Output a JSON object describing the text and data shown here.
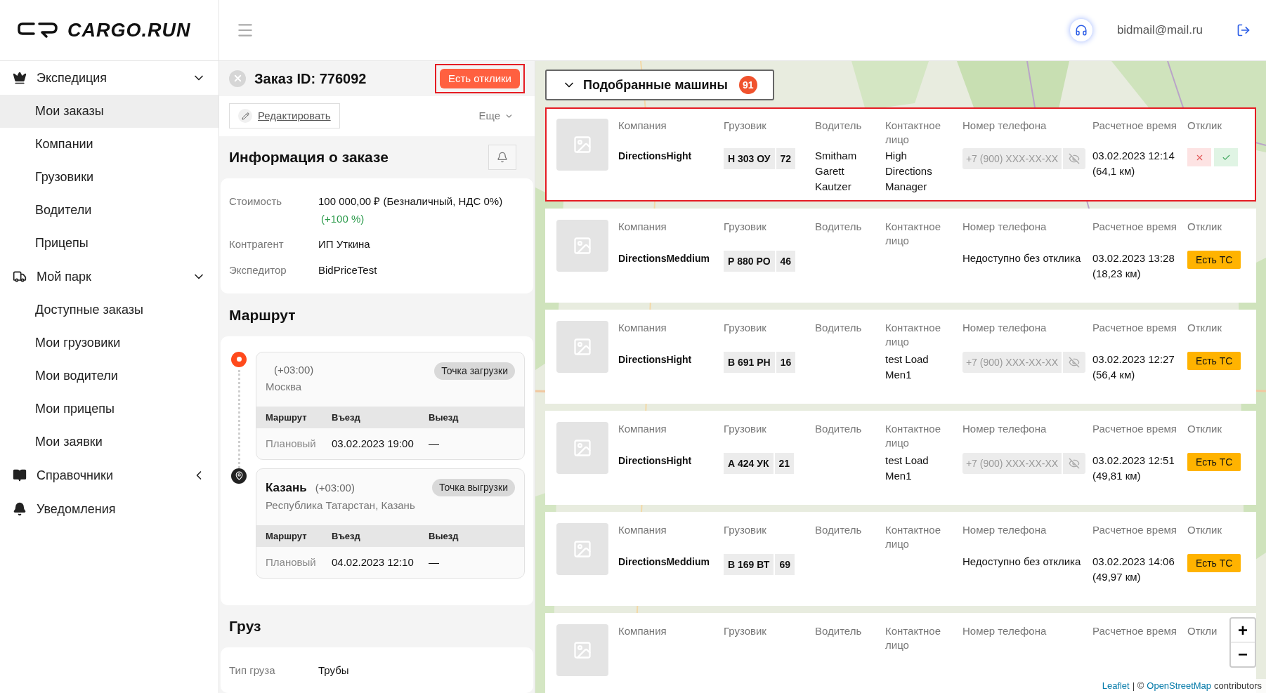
{
  "header": {
    "logo_text": "CARGO.RUN",
    "user_email": "bidmail@mail.ru"
  },
  "sidebar": {
    "groups": [
      {
        "label": "Экспедиция",
        "expanded": true,
        "items": [
          {
            "label": "Мои заказы",
            "selected": true
          },
          {
            "label": "Компании",
            "selected": false
          },
          {
            "label": "Грузовики",
            "selected": false
          },
          {
            "label": "Водители",
            "selected": false
          },
          {
            "label": "Прицепы",
            "selected": false
          }
        ]
      },
      {
        "label": "Мой парк",
        "expanded": true,
        "items": [
          {
            "label": "Доступные заказы",
            "selected": false
          },
          {
            "label": "Мои грузовики",
            "selected": false
          },
          {
            "label": "Мои водители",
            "selected": false
          },
          {
            "label": "Мои прицепы",
            "selected": false
          },
          {
            "label": "Мои заявки",
            "selected": false
          }
        ]
      },
      {
        "label": "Справочники",
        "expanded": false
      },
      {
        "label": "Уведомления"
      }
    ]
  },
  "order": {
    "title": "Заказ ID: 776092",
    "status_button": {
      "label": "Есть отклики",
      "highlighted": true
    },
    "edit_link": "Редактировать",
    "more_label": "Еще",
    "info": {
      "title": "Информация о заказе",
      "rows": [
        {
          "label": "Стоимость",
          "value": "100 000,00 ₽ (Безналичный, НДС 0%)",
          "note": "(+100 %)"
        },
        {
          "label": "Контрагент",
          "value": "ИП Уткина"
        },
        {
          "label": "Экспедитор",
          "value": "BidPriceTest"
        }
      ]
    },
    "route": {
      "title": "Маршрут",
      "points": [
        {
          "kind": "loading",
          "timezone": "(+03:00)",
          "address": "Москва",
          "tag": "Точка загрузки",
          "columns": [
            "Маршрут",
            "Въезд",
            "Выезд"
          ],
          "row": [
            "Плановый",
            "03.02.2023 19:00",
            "—"
          ]
        },
        {
          "kind": "unloading",
          "city": "Казань",
          "timezone": "(+03:00)",
          "address": "Республика Татарстан, Казань",
          "tag": "Точка выгрузки",
          "columns": [
            "Маршрут",
            "Въезд",
            "Выезд"
          ],
          "row": [
            "Плановый",
            "04.02.2023 12:10",
            "—"
          ]
        }
      ]
    },
    "cargo": {
      "title": "Груз",
      "rows": [
        {
          "label": "Тип груза",
          "value": "Трубы"
        }
      ]
    }
  },
  "matches": {
    "title": "Подобранные машины",
    "count": "91",
    "expanded": true,
    "cards": [
      {
        "kind": "response",
        "highlighted": true,
        "labels": [
          "Компания",
          "Грузовик",
          "Водитель",
          "Контактное лицо",
          "Номер телефона",
          "Расчетное время",
          "Отклик"
        ],
        "company": "DirectionsHight",
        "plate": "Н 303 ОУ",
        "region": "72",
        "driver": "Smitham Garett Kautzer",
        "contact": "High Directions Manager",
        "phone_masked": true,
        "phone": "+7 (900) XXX-XX-XX",
        "time": "03.02.2023 12:14",
        "distance": "(64,1 км)"
      },
      {
        "kind": "available",
        "highlighted": false,
        "labels": [
          "Компания",
          "Грузовик",
          "Водитель",
          "Контактное лицо",
          "Номер телефона",
          "Расчетное время",
          "Отклик"
        ],
        "company": "DirectionsMeddium",
        "plate": "Р 880 РО",
        "region": "46",
        "phone_masked": false,
        "phone": "Недоступно без отклика",
        "time": "03.02.2023 13:28",
        "distance": "(18,23 км)",
        "action": "Есть ТС"
      },
      {
        "kind": "available",
        "highlighted": false,
        "labels": [
          "Компания",
          "Грузовик",
          "Водитель",
          "Контактное лицо",
          "Номер телефона",
          "Расчетное время",
          "Отклик"
        ],
        "company": "DirectionsHight",
        "plate": "В 691 РН",
        "region": "16",
        "contact": "test Load Men1",
        "phone_masked": true,
        "phone": "+7 (900) XXX-XX-XX",
        "time": "03.02.2023 12:27",
        "distance": "(56,4 км)",
        "action": "Есть ТС"
      },
      {
        "kind": "available",
        "highlighted": false,
        "labels": [
          "Компания",
          "Грузовик",
          "Водитель",
          "Контактное лицо",
          "Номер телефона",
          "Расчетное время",
          "Отклик"
        ],
        "company": "DirectionsHight",
        "plate": "А 424 УК",
        "region": "21",
        "contact": "test Load Men1",
        "phone_masked": true,
        "phone": "+7 (900) XXX-XX-XX",
        "time": "03.02.2023 12:51",
        "distance": "(49,81 км)",
        "action": "Есть ТС"
      },
      {
        "kind": "available",
        "highlighted": false,
        "labels": [
          "Компания",
          "Грузовик",
          "Водитель",
          "Контактное лицо",
          "Номер телефона",
          "Расчетное время",
          "Отклик"
        ],
        "company": "DirectionsMeddium",
        "plate": "В 169 ВТ",
        "region": "69",
        "phone_masked": false,
        "phone": "Недоступно без отклика",
        "time": "03.02.2023 14:06",
        "distance": "(49,97 км)",
        "action": "Есть ТС"
      },
      {
        "kind": "partial",
        "highlighted": false,
        "labels": [
          "Компания",
          "Грузовик",
          "Водитель",
          "Контактное лицо",
          "Номер телефона",
          "Расчетное время",
          "Откли"
        ]
      }
    ]
  },
  "map": {
    "zoom_in": "+",
    "zoom_out": "−",
    "attribution_link1": "Leaflet",
    "attribution_sep": "| ©",
    "attribution_link2": "OpenStreetMap",
    "attribution_tail": "contributors"
  }
}
